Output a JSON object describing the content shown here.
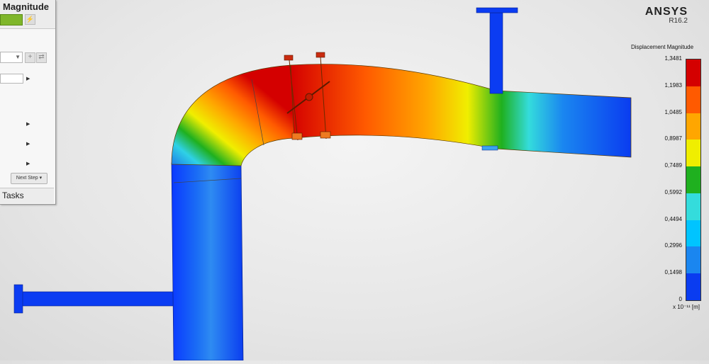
{
  "app": {
    "brand": "ANSYS",
    "version": "R16.2"
  },
  "panel": {
    "title": "Magnitude",
    "swatch_color": "#7fb62a",
    "next_step_label": "Next Step ▾",
    "tasks_label": "Tasks"
  },
  "legend": {
    "title": "Displacement Magnitude",
    "unit": "x 10⁻¹¹ [m]",
    "labels": [
      "1,3481",
      "1,1983",
      "1,0485",
      "0,8987",
      "0,7489",
      "0,5992",
      "0,4494",
      "0,2996",
      "0,1498",
      "0"
    ],
    "colors": [
      "#d40000",
      "#ff5a00",
      "#ffa600",
      "#f0ee00",
      "#1fb01f",
      "#34dcdc",
      "#00c4ff",
      "#1a86f0",
      "#0a3cf0"
    ]
  }
}
